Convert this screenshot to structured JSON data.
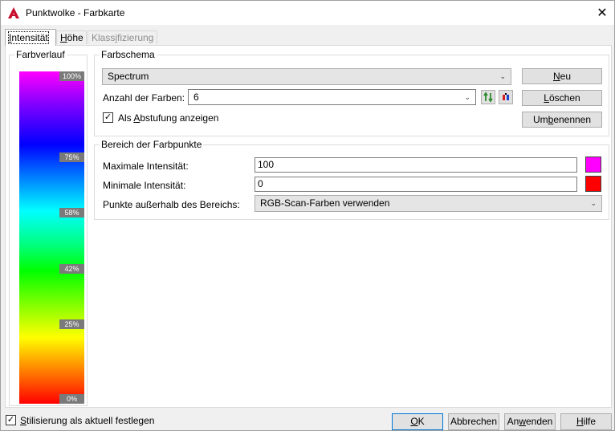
{
  "window": {
    "title": "Punktwolke - Farbkarte"
  },
  "tabs": [
    {
      "label": "Intensität",
      "u": "I",
      "rest": "ntensität"
    },
    {
      "label": "Höhe",
      "pre": "",
      "u": "H",
      "rest": "öhe"
    },
    {
      "label": "Klassifizierung",
      "pre": "Klass",
      "u": "i",
      "rest": "fizierung"
    }
  ],
  "farbverlauf": {
    "title": "Farbverlauf",
    "ticks": [
      "100%",
      "75%",
      "58%",
      "42%",
      "25%",
      "0%"
    ]
  },
  "farbschema": {
    "title": "Farbschema",
    "scheme_value": "Spectrum",
    "count_label": "Anzahl der Farben:",
    "count_value": "6",
    "stepping_label_pre": "Als ",
    "stepping_label_u": "A",
    "stepping_label_rest": "bstufung anzeigen",
    "stepping_checked": "✓",
    "buttons": {
      "new": {
        "u": "N",
        "rest": "eu"
      },
      "delete": {
        "u": "L",
        "rest": "öschen"
      },
      "rename": {
        "pre": "Um",
        "u": "b",
        "rest": "enennen"
      }
    }
  },
  "bereich": {
    "title": "Bereich der Farbpunkte",
    "max_label": "Maximale Intensität:",
    "max_value": "100",
    "max_color": "#ff00ff",
    "min_label": "Minimale Intensität:",
    "min_value": "0",
    "min_color": "#ff0000",
    "outside_label": "Punkte außerhalb des Bereichs:",
    "outside_value": "RGB-Scan-Farben verwenden"
  },
  "footer": {
    "stylize_u": "S",
    "stylize_rest": "tilisierung als aktuell festlegen",
    "stylize_checked": "✓",
    "ok": {
      "u": "O",
      "rest": "K"
    },
    "cancel": {
      "label": "Abbrechen"
    },
    "apply": {
      "pre": "An",
      "u": "w",
      "rest": "enden"
    },
    "help": {
      "u": "H",
      "rest": "ilfe"
    }
  }
}
